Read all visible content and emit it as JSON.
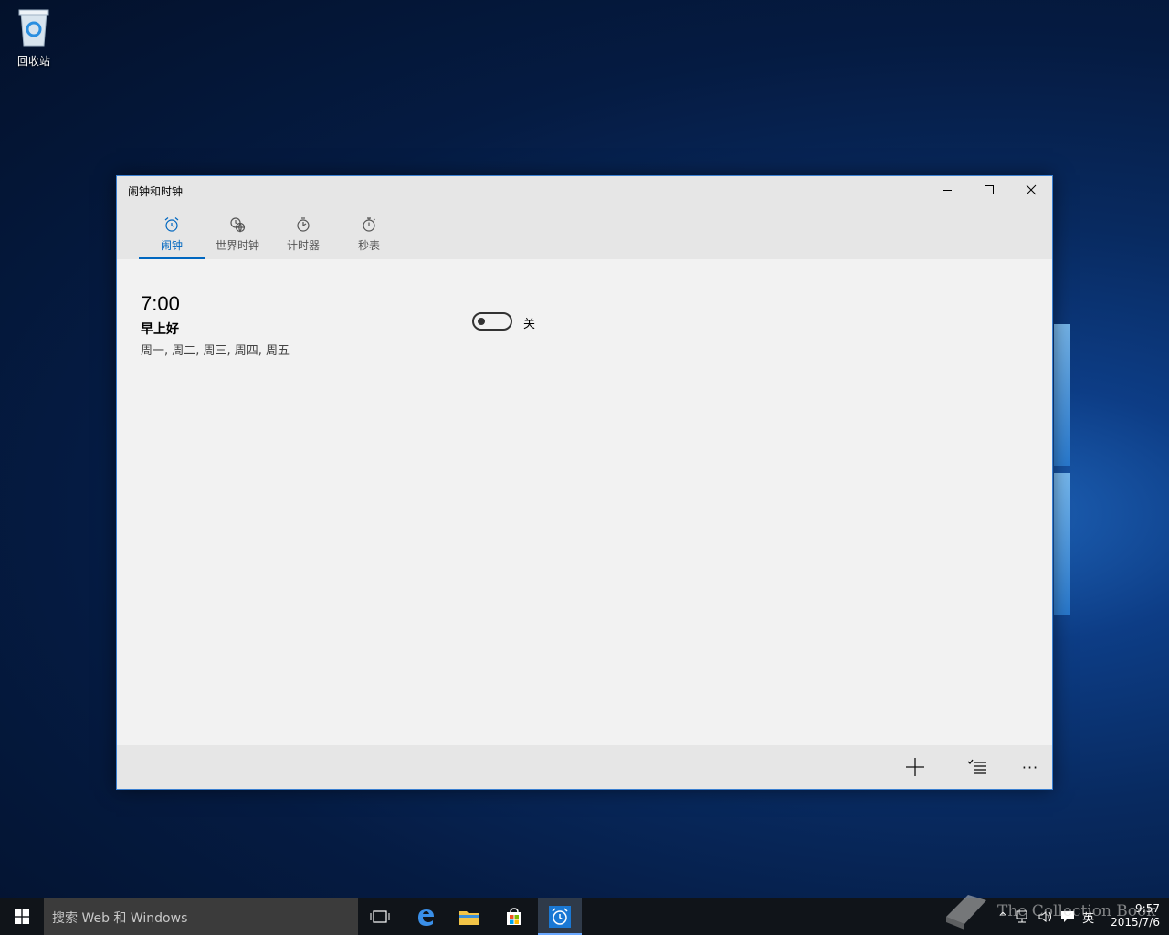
{
  "desktop": {
    "recycle_bin_label": "回收站"
  },
  "window": {
    "title": "闹钟和时钟",
    "tabs": [
      {
        "label": "闹钟",
        "icon": "alarm-clock-icon",
        "active": true
      },
      {
        "label": "世界时钟",
        "icon": "world-clock-icon",
        "active": false
      },
      {
        "label": "计时器",
        "icon": "timer-icon",
        "active": false
      },
      {
        "label": "秒表",
        "icon": "stopwatch-icon",
        "active": false
      }
    ],
    "alarm": {
      "time": "7:00",
      "name": "早上好",
      "days": "周一, 周二, 周三, 周四, 周五",
      "toggle_label": "关",
      "enabled": false
    },
    "appbar": {
      "add_icon": "plus-icon",
      "select_icon": "select-list-icon",
      "more_label": "···"
    }
  },
  "taskbar": {
    "search_placeholder": "搜索 Web 和 Windows",
    "ime_label": "英",
    "time": "9:57",
    "date": "2015/7/6",
    "watermark": "The Collection Book"
  },
  "colors": {
    "accent": "#0067c0",
    "window_bg": "#f2f2f2",
    "chrome_bg": "#e6e6e6",
    "taskbar_bg": "#101419"
  }
}
